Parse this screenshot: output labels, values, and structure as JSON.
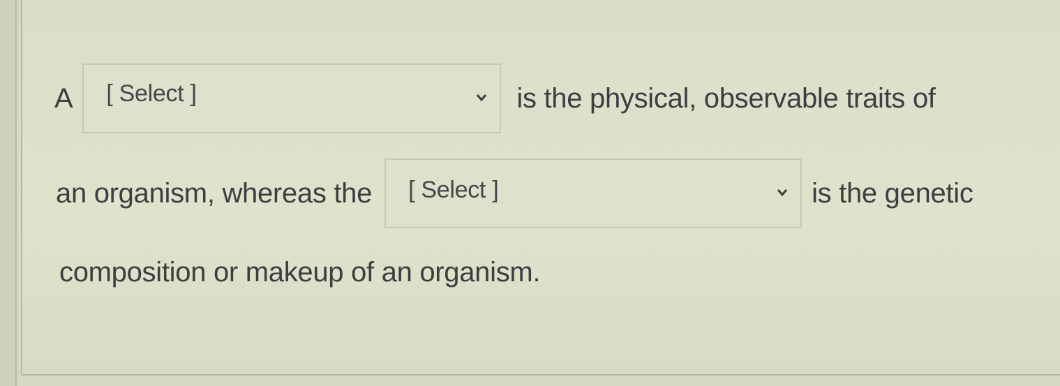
{
  "question": {
    "line1_prefix": "A",
    "line1_suffix": "is the physical, observable traits of",
    "line2_prefix": "an organism, whereas the",
    "line2_suffix": "is the genetic",
    "line3": "composition or makeup of an organism."
  },
  "dropdowns": [
    {
      "selected": "[ Select ]",
      "icon": "chevron-down-icon"
    },
    {
      "selected": "[ Select ]",
      "icon": "chevron-down-icon"
    }
  ],
  "colors": {
    "background": "#d9dbc6",
    "text": "#3c3e40",
    "border": "#c5c8b4"
  }
}
